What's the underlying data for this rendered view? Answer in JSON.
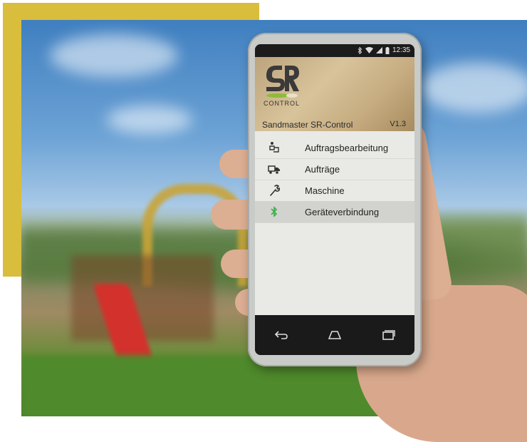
{
  "status_bar": {
    "time": "12:35",
    "icons": [
      "bluetooth-icon",
      "wifi-icon",
      "signal-icon",
      "battery-icon"
    ]
  },
  "header": {
    "logo_letters": "SR",
    "logo_subtext": "CONTROL",
    "app_title": "Sandmaster SR-Control",
    "version": "V1.3"
  },
  "menu": {
    "items": [
      {
        "label": "Auftragsbearbeitung",
        "icon": "worker-desk-icon"
      },
      {
        "label": "Aufträge",
        "icon": "truck-icon"
      },
      {
        "label": "Maschine",
        "icon": "wrench-icon"
      },
      {
        "label": "Geräteverbindung",
        "icon": "bluetooth-icon",
        "active": true
      }
    ]
  },
  "navbar": {
    "buttons": [
      "back-icon",
      "home-icon",
      "recent-apps-icon"
    ]
  },
  "colors": {
    "accent_bar": "#d9bd3c",
    "menu_background": "#e9eae6",
    "bluetooth_green": "#3dae4b",
    "logo_green": "#8dbb3a"
  }
}
